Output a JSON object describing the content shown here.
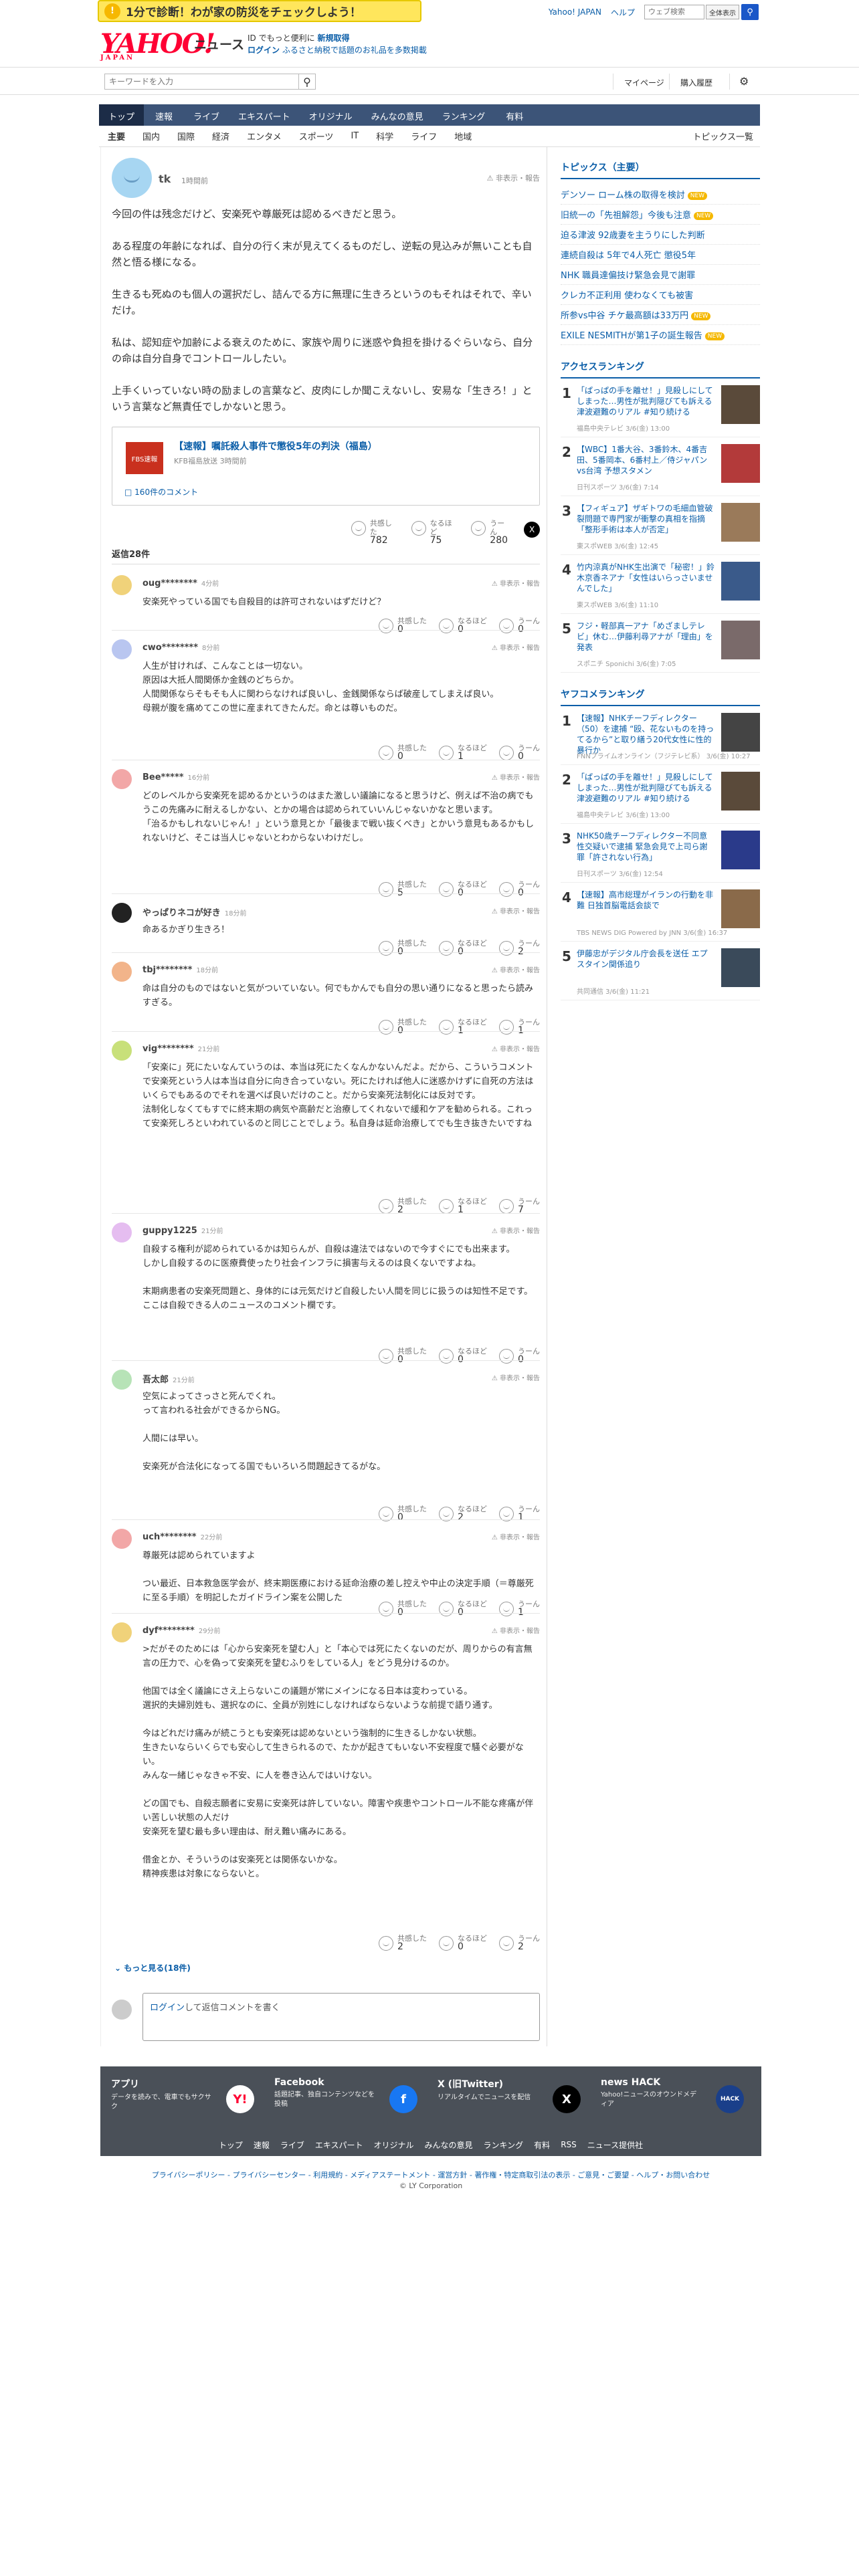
{
  "promo": {
    "text": "1分で診断！わが家の防災をチェックしよう！"
  },
  "toplinks": {
    "yj": "Yahoo! JAPAN",
    "help": "ヘルプ",
    "search_placeholder": "ウェブ検索",
    "search_btn": "全体表示"
  },
  "logo": {
    "brand": "YAHOO!",
    "sub": "JAPAN",
    "service": "ニュース",
    "line1a": "ID でもっと便利に",
    "line1b": "新規取得",
    "line2a": "ログイン",
    "line2b": "ふるさと納税で話題のお礼品を多数掲載"
  },
  "searchbar": {
    "placeholder": "キーワードを入力",
    "mypage": "マイページ",
    "history": "購入履歴"
  },
  "nav": [
    "トップ",
    "速報",
    "ライブ",
    "エキスパート",
    "オリジナル",
    "みんなの意見",
    "ランキング",
    "有料"
  ],
  "subnav": {
    "items": [
      "主要",
      "国内",
      "国際",
      "経済",
      "エンタメ",
      "スポーツ",
      "IT",
      "科学",
      "ライフ",
      "地域"
    ],
    "right": "トピックス一覧"
  },
  "post": {
    "user": "tk",
    "time": "1時間前",
    "report": "非表示・報告",
    "paragraphs": [
      "今回の件は残念だけど、安楽死や尊厳死は認めるべきだと思う。",
      "ある程度の年齢になれば、自分の行く末が見えてくるものだし、逆転の見込みが無いことも自然と悟る様になる。",
      "生きるも死ぬのも個人の選択だし、詰んでる方に無理に生きろというのもそれはそれで、辛いだけ。",
      "私は、認知症や加齢による衰えのために、家族や周りに迷惑や負担を掛けるぐらいなら、自分の命は自分自身でコントロールしたい。",
      "上手くいっていない時の励ましの言葉など、皮肉にしか聞こえないし、安易な「生きろ！」という言葉など無責任でしかないと思う。"
    ],
    "card": {
      "thumb": "FBS速報",
      "title": "【速報】嘱託殺人事件で懲役5年の判決（福島）",
      "source": "KFB福島放送 3時間前",
      "comments": "160件のコメント"
    },
    "reactions": [
      {
        "label": "共感した",
        "count": "782"
      },
      {
        "label": "なるほど",
        "count": "75"
      },
      {
        "label": "うーん",
        "count": "280"
      }
    ]
  },
  "replies": {
    "count_label": "返信28件"
  },
  "comments": [
    {
      "user": "oug********",
      "time": "4分前",
      "text": [
        "安楽死やっている国でも自殺目的は許可されないはずだけど？"
      ],
      "reactions": [
        "0",
        "0",
        "0"
      ],
      "color": "#f0d27a"
    },
    {
      "user": "cwo********",
      "time": "8分前",
      "text": [
        "人生が甘ければ、こんなことは一切ない。",
        "原因は大抵人間関係か金銭のどちらか。",
        "人間関係ならそもそも人に関わらなければ良いし、金銭関係ならば破産してしまえば良い。",
        "母親が腹を痛めてこの世に産まれてきたんだ。命とは尊いものだ。"
      ],
      "reactions": [
        "0",
        "1",
        "0"
      ],
      "color": "#b9c6f0"
    },
    {
      "user": "Bee*****",
      "time": "16分前",
      "text": [
        "どのレベルから安楽死を認めるかというのはまた激しい議論になると思うけど、例えば不治の病でもうこの先痛みに耐えるしかない、とかの場合は認められていいんじゃないかなと思います。",
        "「治るかもしれないじゃん！」という意見とか「最後まで戦い抜くべき」とかいう意見もあるかもしれないけど、そこは当人じゃないとわからないわけだし。"
      ],
      "reactions": [
        "5",
        "0",
        "0"
      ],
      "color": "#f2a7a7"
    },
    {
      "user": "やっぱりネコが好き",
      "time": "18分前",
      "text": [
        "命あるかぎり生きろ！"
      ],
      "reactions": [
        "0",
        "0",
        "2"
      ],
      "color": "#222"
    },
    {
      "user": "tbj********",
      "time": "18分前",
      "text": [
        "命は自分のものではないと気がついていない。何でもかんでも自分の思い通りになると思ったら読みすぎる。"
      ],
      "reactions": [
        "0",
        "1",
        "1"
      ],
      "color": "#f2b48a"
    },
    {
      "user": "vig********",
      "time": "21分前",
      "text": [
        "「安楽に」死にたいなんていうのは、本当は死にたくなんかないんだよ。だから、こういうコメントで安楽死という人は本当は自分に向き合っていない。死にたければ他人に迷惑かけずに自死の方法はいくらでもあるのでそれを選べば良いだけのこと。だから安楽死法制化には反対です。",
        "法制化しなくてもすでに終末期の病気や高齢だと治療してくれないで緩和ケアを勧められる。これって安楽死しろといわれているのと同じことでしょう。私自身は延命治療してでも生き抜きたいですね"
      ],
      "reactions": [
        "2",
        "1",
        "7"
      ],
      "color": "#c8e07a"
    },
    {
      "user": "guppy1225",
      "time": "21分前",
      "text": [
        "自殺する権利が認められているかは知らんが、自殺は違法ではないので今すぐにでも出来ます。",
        "しかし自殺するのに医療費使ったり社会インフラに損害与えるのは良くないですよね。",
        "",
        "末期病患者の安楽死問題と、身体的には元気だけど自殺したい人間を同じに扱うのは知性不足です。",
        "ここは自殺できる人のニュースのコメント欄です。"
      ],
      "reactions": [
        "0",
        "0",
        "0"
      ],
      "color": "#e5bdf0"
    },
    {
      "user": "吾太郎",
      "time": "21分前",
      "text": [
        "空気によってさっさと死んでくれ。",
        "って言われる社会ができるからNG。",
        "",
        "人間には早い。",
        "",
        "安楽死が合法化になってる国でもいろいろ問題起きてるがな。"
      ],
      "reactions": [
        "0",
        "2",
        "1"
      ],
      "color": "#b7e3b7"
    },
    {
      "user": "uch********",
      "time": "22分前",
      "text": [
        "尊厳死は認められていますよ",
        "",
        "つい最近、日本救急医学会が、終末期医療における延命治療の差し控えや中止の決定手順（＝尊厳死に至る手順）を明記したガイドライン案を公開した"
      ],
      "reactions": [
        "0",
        "0",
        "1"
      ],
      "color": "#f2a7a7"
    },
    {
      "user": "dyf********",
      "time": "29分前",
      "text": [
        ">だがそのためには「心から安楽死を望む人」と「本心では死にたくないのだが、周りからの有言無言の圧力で、心を偽って安楽死を望むふりをしている人」をどう見分けるのか。",
        "",
        "他国では全く議論にさえ上らないこの議題が常にメインになる日本は変わっている。",
        "選択的夫婦別姓も、選択なのに、全員が別姓にしなければならないような前提で語り通す。",
        "",
        "今はどれだけ痛みが続こうとも安楽死は認めないという強制的に生きるしかない状態。",
        "生きたいならいくらでも安心して生きられるので、たかが起きてもいない不安程度で騒ぐ必要がない。",
        "みんな一緒じゃなきゃ不安、に人を巻き込んではいけない。",
        "",
        "どの国でも、自殺志願者に安易に安楽死は許していない。障害や疾患やコントロール不能な疼痛が伴い苦しい状態の人だけ",
        "安楽死を望む最も多い理由は、耐え難い痛みにある。",
        "",
        "借金とか、そういうのは安楽死とは関係ないかな。",
        "精神疾患は対象にならないと。"
      ],
      "reactions": [
        "2",
        "0",
        "2"
      ],
      "color": "#f0d27a"
    }
  ],
  "more": "もっと見る(18件)",
  "reply_box": {
    "login": "ログイン",
    "rest": "して返信コメントを書く"
  },
  "sidebar": {
    "topics_head": "トピックス（主要）",
    "topics": [
      {
        "t": "デンソー ローム株の取得を検討",
        "new": true
      },
      {
        "t": "旧統一の「先祖解怨」今後も注意",
        "new": true
      },
      {
        "t": "迫る津波 92歳妻を主うりにした判断",
        "new": false
      },
      {
        "t": "連続自殺は 5年で4人死亡 懲役5年",
        "new": false
      },
      {
        "t": "NHK 職員達偏技け緊急会見で謝罪",
        "new": false
      },
      {
        "t": "クレカ不正利用 使わなくても被害",
        "new": false
      },
      {
        "t": "所参vs中谷 チケ最高額は33万円",
        "new": true
      },
      {
        "t": "EXILE NESMITHが第1子の誕生報告",
        "new": true
      }
    ],
    "new_label": "NEW",
    "access_head": "アクセスランキング",
    "access": [
      {
        "t": "「ぱっぱの手を離せ！」見殺しにしてしまった…男性が批判隠びても訴える津波避難のリアル #知り続ける",
        "s": "福島中央テレビ 3/6(金) 13:00"
      },
      {
        "t": "【WBC】1番大谷、3番鈴木、4番吉田、5番岡本、6番村上／侍ジャパンvs台湾 予想スタメン",
        "s": "日刊スポーツ 3/6(金) 7:14"
      },
      {
        "t": "【フィギュア】ザギトワの毛細血管破裂問題で専門家が衝撃の真相を指摘「整形手術は本人が否定」",
        "s": "東スポWEB 3/6(金) 12:45"
      },
      {
        "t": "竹内涼真がNHK生出演で「秘密！」鈴木京香ネアナ「女性はいらっさいませんでした」",
        "s": "東スポWEB 3/6(金) 11:10"
      },
      {
        "t": "フジ・軽部真一アナ「めざましテレビ」休む…伊藤利尋アナが「理由」を発表",
        "s": "スポニチ Sponichi 3/6(金) 7:05"
      }
    ],
    "yahoo_head": "ヤフコメランキング",
    "yahoo": [
      {
        "t": "【速報】NHKチーフディレクター（50）を逮捕 “殴、花ないものを持ってるから”と取り繕う20代女性に性的暴行か",
        "s": "FNNプライムオンライン（フジテレビ系） 3/6(金) 10:27"
      },
      {
        "t": "「ぱっぱの手を離せ！」見殺しにしてしまった…男性が批判隠びても訴える津波避難のリアル #知り続ける",
        "s": "福島中央テレビ 3/6(金) 13:00"
      },
      {
        "t": "NHK50歳チーフディレクター不同意性交疑いで逮捕 緊急会見で上司ら謝罪「許されない行為」",
        "s": "日刊スポーツ 3/6(金) 12:54"
      },
      {
        "t": "【速報】高市総理がイランの行動を非難 日独首脳電話会談で",
        "s": "TBS NEWS DIG Powered by JNN 3/6(金) 16:37"
      },
      {
        "t": "伊藤忠がデジタル庁会長を送任 エプスタイン関係追り",
        "s": "共同通信 3/6(金) 11:21"
      }
    ]
  },
  "footer": {
    "apps": [
      {
        "h": "アプリ",
        "d": "データを読みで、電車でもサクサク",
        "icon": "Y!"
      },
      {
        "h": "Facebook",
        "d": "話題記事、独自コンテンツなどを投稿",
        "icon": "f"
      },
      {
        "h": "X (旧Twitter)",
        "d": "リアルタイムでニュースを配信",
        "icon": "X"
      },
      {
        "h": "news HACK",
        "d": "Yahoo!ニュースのオウンドメディア",
        "icon": "HACK"
      }
    ],
    "nav": [
      "トップ",
      "速報",
      "ライブ",
      "エキスパート",
      "オリジナル",
      "みんなの意見",
      "ランキング",
      "有料",
      "RSS",
      "ニュース提供社"
    ],
    "links": "プライバシーポリシー - プライバシーセンター - 利用規約 - メディアステートメント - 運営方針 - 著作権・特定商取引法の表示 - ご意見・ご要望 - ヘルプ・お問い合わせ",
    "copyright": "© LY Corporation"
  }
}
